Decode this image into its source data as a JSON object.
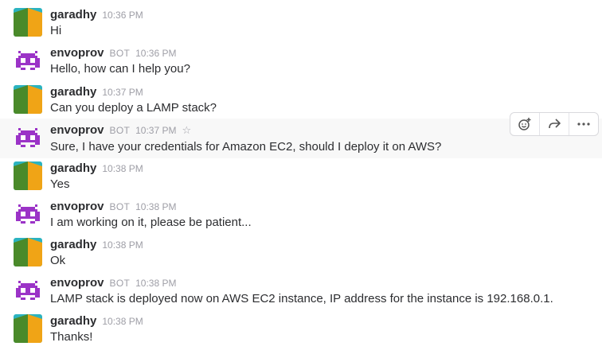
{
  "messages": [
    {
      "user": "garadhy",
      "type": "human",
      "time": "10:36 PM",
      "text": "Hi"
    },
    {
      "user": "envoprov",
      "type": "bot",
      "bot_label": "BOT",
      "time": "10:36 PM",
      "text": "Hello, how can I help you?"
    },
    {
      "user": "garadhy",
      "type": "human",
      "time": "10:37 PM",
      "text": "Can you deploy a LAMP stack?"
    },
    {
      "user": "envoprov",
      "type": "bot",
      "bot_label": "BOT",
      "time": "10:37 PM",
      "text": "Sure, I have your credentials for Amazon EC2, should I deploy it on AWS?",
      "hovered": true
    },
    {
      "user": "garadhy",
      "type": "human",
      "time": "10:38 PM",
      "text": "Yes"
    },
    {
      "user": "envoprov",
      "type": "bot",
      "bot_label": "BOT",
      "time": "10:38 PM",
      "text": "I am working on it, please be patient..."
    },
    {
      "user": "garadhy",
      "type": "human",
      "time": "10:38 PM",
      "text": "Ok"
    },
    {
      "user": "envoprov",
      "type": "bot",
      "bot_label": "BOT",
      "time": "10:38 PM",
      "text": "LAMP stack is deployed now on AWS EC2 instance, IP address for the instance is 192.168.0.1."
    },
    {
      "user": "garadhy",
      "type": "human",
      "time": "10:38 PM",
      "text": "Thanks!"
    }
  ],
  "hover_actions": [
    {
      "icon": "add-reaction-icon"
    },
    {
      "icon": "share-icon"
    },
    {
      "icon": "more-actions-icon"
    }
  ],
  "colors": {
    "human_avatar": [
      "#2bb3c0",
      "#4a8a2a",
      "#f0a416"
    ],
    "bot_avatar": "#9b33c7"
  }
}
